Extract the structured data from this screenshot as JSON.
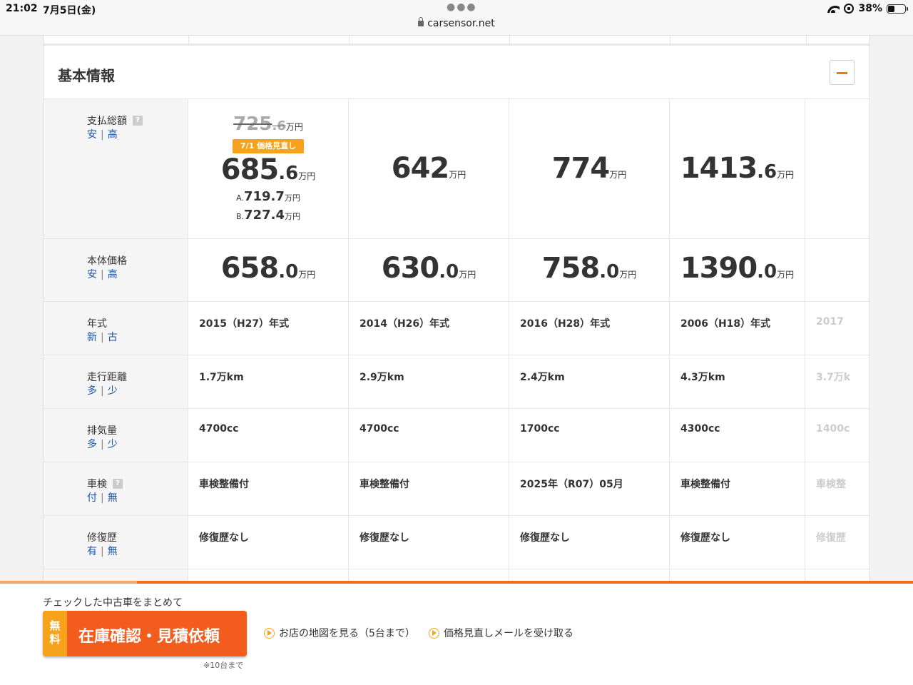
{
  "status_bar": {
    "time": "21:02",
    "date": "7月5日(金)",
    "url": "carsensor.net",
    "battery": "38%"
  },
  "section": {
    "title": "基本情報"
  },
  "sort_labels": {
    "price": [
      "安",
      "高"
    ],
    "year": [
      "新",
      "古"
    ],
    "mileage": [
      "多",
      "少"
    ],
    "displacement": [
      "多",
      "少"
    ],
    "inspection": [
      "付",
      "無"
    ],
    "repair": [
      "有",
      "無"
    ]
  },
  "rows": {
    "total": {
      "label": "支払総額",
      "help": "?",
      "old_price_int": "725",
      "old_price_dec": ".6",
      "unit": "万円",
      "badge": "7/1 価格見直し",
      "values": [
        {
          "int": "685",
          "dec": ".6"
        },
        {
          "int": "642",
          "dec": ""
        },
        {
          "int": "774",
          "dec": ""
        },
        {
          "int": "1413",
          "dec": ".6"
        }
      ],
      "sub_a_prefix": "A.",
      "sub_a_value": "719.7",
      "sub_b_prefix": "B.",
      "sub_b_value": "727.4"
    },
    "body": {
      "label": "本体価格",
      "unit": "万円",
      "values": [
        {
          "int": "658",
          "dec": ".0"
        },
        {
          "int": "630",
          "dec": ".0"
        },
        {
          "int": "758",
          "dec": ".0"
        },
        {
          "int": "1390",
          "dec": ".0"
        }
      ]
    },
    "year": {
      "label": "年式",
      "values": [
        "2015（H27）年式",
        "2014（H26）年式",
        "2016（H28）年式",
        "2006（H18）年式",
        "2017"
      ]
    },
    "mileage": {
      "label": "走行距離",
      "values": [
        "1.7万km",
        "2.9万km",
        "2.4万km",
        "4.3万km",
        "3.7万k"
      ]
    },
    "displacement": {
      "label": "排気量",
      "values": [
        "4700cc",
        "4700cc",
        "1700cc",
        "4300cc",
        "1400c"
      ]
    },
    "inspection": {
      "label": "車検",
      "help": "?",
      "values": [
        "車検整備付",
        "車検整備付",
        "2025年（R07）05月",
        "車検整備付",
        "車検整"
      ]
    },
    "repair": {
      "label": "修復歴",
      "values": [
        "修復歴なし",
        "修復歴なし",
        "修復歴なし",
        "修復歴なし",
        "修復歴"
      ]
    }
  },
  "bottom_bar": {
    "label": "チェックした中古車をまとめて",
    "free": "無料",
    "cta": "在庫確認・見積依頼",
    "note": "※10台まで",
    "link_map": "お店の地図を見る（5台まで）",
    "link_mail": "価格見直しメールを受け取る"
  }
}
